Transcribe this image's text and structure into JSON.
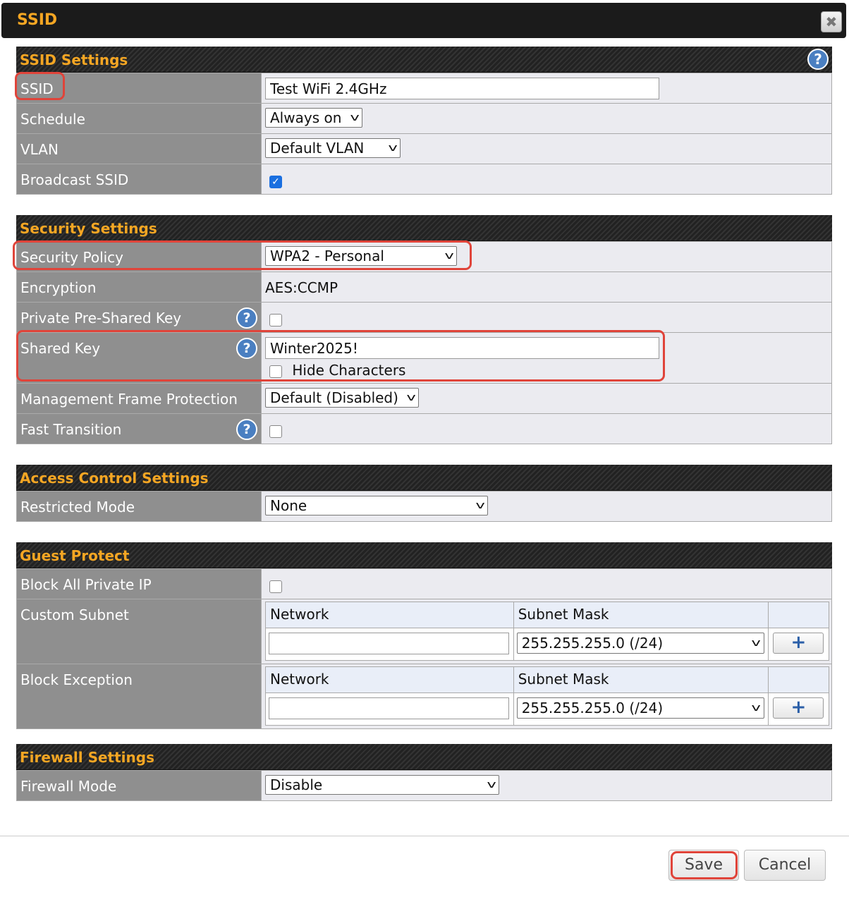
{
  "dialog": {
    "title": "SSID",
    "close_glyph": "✖"
  },
  "ssid_settings": {
    "header": "SSID Settings",
    "ssid_label": "SSID",
    "ssid_value": "Test WiFi 2.4GHz",
    "schedule_label": "Schedule",
    "schedule_value": "Always on",
    "vlan_label": "VLAN",
    "vlan_value": "Default VLAN",
    "broadcast_label": "Broadcast SSID",
    "broadcast_checked": true
  },
  "security_settings": {
    "header": "Security Settings",
    "policy_label": "Security Policy",
    "policy_value": "WPA2 - Personal",
    "encryption_label": "Encryption",
    "encryption_value": "AES:CCMP",
    "ppsk_label": "Private Pre-Shared Key",
    "ppsk_checked": false,
    "shared_key_label": "Shared Key",
    "shared_key_value": "Winter2025!",
    "hide_chars_label": "Hide Characters",
    "hide_chars_checked": false,
    "mfp_label": "Management Frame Protection",
    "mfp_value": "Default (Disabled)",
    "fast_transition_label": "Fast Transition",
    "fast_transition_checked": false
  },
  "access_control": {
    "header": "Access Control Settings",
    "restricted_label": "Restricted Mode",
    "restricted_value": "None"
  },
  "guest_protect": {
    "header": "Guest Protect",
    "block_private_label": "Block All Private IP",
    "block_private_checked": false,
    "custom_subnet_label": "Custom Subnet",
    "block_exception_label": "Block Exception",
    "network_header": "Network",
    "mask_header": "Subnet Mask",
    "custom_subnet_mask_value": "255.255.255.0 (/24)",
    "block_exception_mask_value": "255.255.255.0 (/24)",
    "add_glyph": "+"
  },
  "firewall": {
    "header": "Firewall Settings",
    "mode_label": "Firewall Mode",
    "mode_value": "Disable"
  },
  "footer": {
    "save_label": "Save",
    "cancel_label": "Cancel"
  },
  "help_glyph": "?",
  "chevron_glyph": "v",
  "colors": {
    "accent": "#f5a623",
    "highlight": "#e0443a",
    "label_bg": "#8f8f8f",
    "value_bg": "#ebebf0",
    "help_blue": "#4a7fc1"
  }
}
